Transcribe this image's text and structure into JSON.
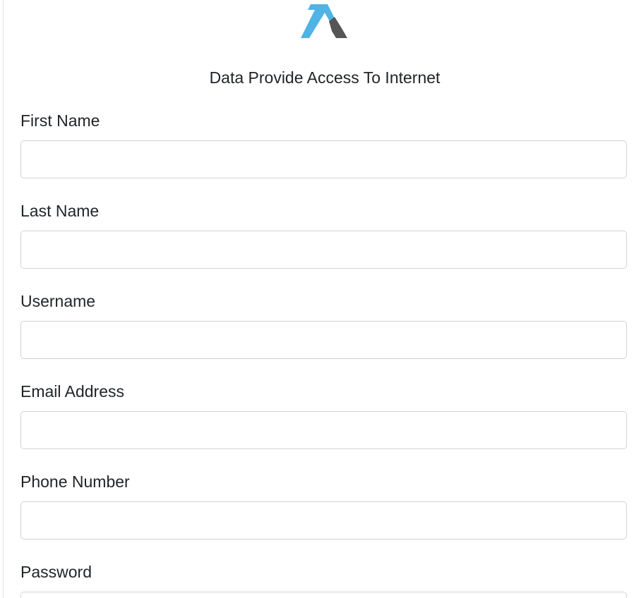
{
  "header": {
    "logo_icon": "brand-arrow-logo-icon",
    "subtitle": "Data Provide Access To Internet"
  },
  "colors": {
    "logo_blue": "#4fb3e6",
    "logo_gray": "#555555"
  },
  "form": {
    "fields": [
      {
        "label": "First Name",
        "value": ""
      },
      {
        "label": "Last Name",
        "value": ""
      },
      {
        "label": "Username",
        "value": ""
      },
      {
        "label": "Email Address",
        "value": ""
      },
      {
        "label": "Phone Number",
        "value": ""
      },
      {
        "label": "Password",
        "value": ""
      }
    ]
  }
}
